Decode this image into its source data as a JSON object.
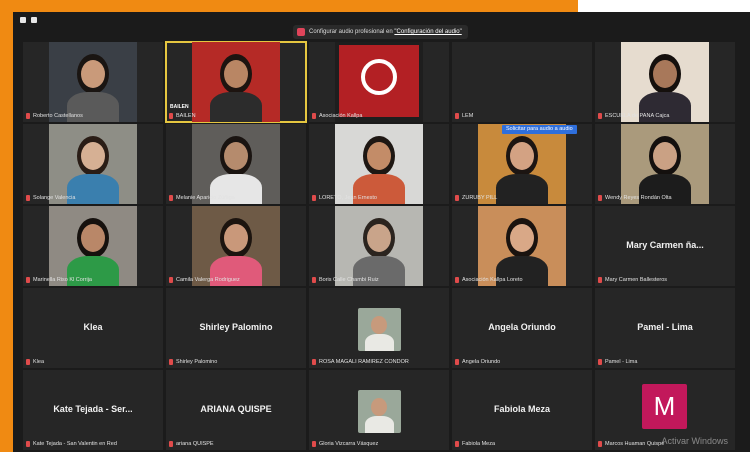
{
  "meeting": {
    "audio_notice_prefix": "Configurar audio profesional en",
    "audio_notice_link": "\"Configuración del audio\"",
    "speaking_tooltip": "Solicitar para audio a audio",
    "active_tile_caption": "BAILEN"
  },
  "participants": [
    {
      "name": "Roberto Castellanos",
      "mode": "video"
    },
    {
      "name": "BAILEN",
      "mode": "video"
    },
    {
      "name": "Asociación Kallpa",
      "mode": "video"
    },
    {
      "name": "LEM",
      "mode": "empty"
    },
    {
      "name": "ESCUELA de PANA Cajca",
      "mode": "video"
    },
    {
      "name": "Solange Valencia",
      "mode": "video"
    },
    {
      "name": "Melanie Aparicio Zúñiga",
      "mode": "video"
    },
    {
      "name": "LORETO, Jean Ernesto",
      "mode": "video"
    },
    {
      "name": "ZURUBY PILL",
      "mode": "video"
    },
    {
      "name": "Wendy Reyes Rondán Olta",
      "mode": "video"
    },
    {
      "name": "Marinella Riso Kl Corrija",
      "mode": "video"
    },
    {
      "name": "Camila Valerga Rodriguez",
      "mode": "video"
    },
    {
      "name": "Boris Calle Chambi Ruiz",
      "mode": "video"
    },
    {
      "name": "Asociación Kallpa Loreto",
      "mode": "video"
    },
    {
      "name": "Mary Carmen Ballesteros",
      "mode": "name",
      "display": "Mary Carmen ña..."
    },
    {
      "name": "Klea",
      "mode": "name",
      "display": "Klea"
    },
    {
      "name": "Shirley Palomino",
      "mode": "name",
      "display": "Shirley Palomino"
    },
    {
      "name": "ROSA MAGALI RAMIREZ CONDOR",
      "mode": "photo"
    },
    {
      "name": "Angela Oriundo",
      "mode": "name",
      "display": "Angela Oriundo"
    },
    {
      "name": "Pamel - Lima",
      "mode": "name",
      "display": "Pamel - Lima"
    },
    {
      "name": "Kate Tejada - San Valentin en Red",
      "mode": "name",
      "display": "Kate Tejada - Ser..."
    },
    {
      "name": "ariana QUISPE",
      "mode": "name",
      "display": "ARIANA QUISPE"
    },
    {
      "name": "Gloria Vizcarra Vásquez",
      "mode": "photo"
    },
    {
      "name": "Fabiola Meza",
      "mode": "name",
      "display": "Fabiola Meza"
    },
    {
      "name": "Marcos Huaman Quispe",
      "mode": "avatar",
      "initial": "M"
    }
  ],
  "os_watermark": "Activar Windows",
  "colors": {
    "frame_accent": "#f08a12",
    "tile_bg": "#262626",
    "active_border": "#e5c640",
    "avatar_bg": "#c2185b",
    "logo_red": "#b32024"
  }
}
